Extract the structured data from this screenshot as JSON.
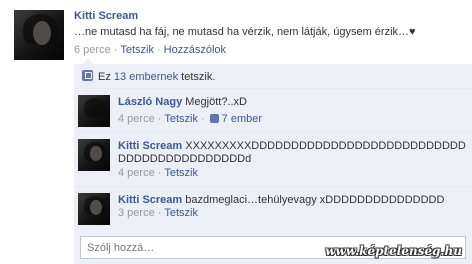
{
  "post": {
    "author": "Kitti Scream",
    "text": "…ne mutasd ha fáj, ne mutasd ha vérzik, nem látják, úgysem érzik…♥",
    "time": "6 perce",
    "like_label": "Tetszik",
    "comment_label": "Hozzászólok"
  },
  "likes": {
    "prefix": "Ez ",
    "count_link": "13 embernek",
    "suffix": " tetszik."
  },
  "comments": [
    {
      "author": "László Nagy",
      "text": "Megjött?..xD",
      "time": "4 perce",
      "like_label": "Tetszik",
      "likes_count": "7 ember"
    },
    {
      "author": "Kitti Scream",
      "text": "XXXXXXXXXDDDDDDDDDDDDDDDDDDDDDDDDDDDDDDDDDDDDDDDDDDDd",
      "time": "4 perce",
      "like_label": "Tetszik"
    },
    {
      "author": "Kitti Scream",
      "text": "bazdmeglaci…tehülyevagy xDDDDDDDDDDDDDDD",
      "time": "3 perce",
      "like_label": "Tetszik"
    }
  ],
  "reply": {
    "placeholder": "Szólj hozzá…"
  },
  "watermark": "www.képtelenség.hu",
  "separator": "·"
}
